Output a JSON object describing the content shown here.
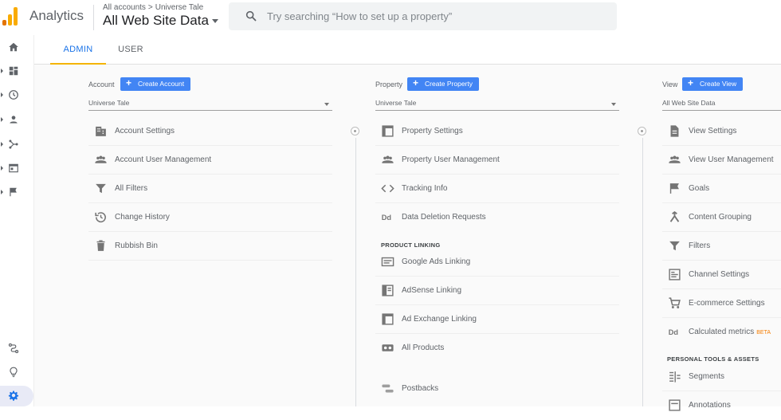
{
  "header": {
    "app_name": "Analytics",
    "breadcrumb": [
      "All accounts",
      "Universe Tale"
    ],
    "breadcrumb_sep": ">",
    "view_title": "All Web Site Data",
    "search_placeholder": "Try searching “How to set up a property”"
  },
  "colors": {
    "accent": "#1a73e8",
    "button": "#4285f4",
    "tab_underline": "#f4b400",
    "beta": "#f57c00"
  },
  "rail": {
    "items": [
      "home-icon",
      "dashboard-icon",
      "clock-icon",
      "person-icon",
      "acquisition-icon",
      "behavior-icon",
      "flag-icon"
    ],
    "bottom": [
      "attribution-icon",
      "lightbulb-icon",
      "gear-icon"
    ]
  },
  "tabs": [
    {
      "label": "ADMIN",
      "active": true
    },
    {
      "label": "USER",
      "active": false
    }
  ],
  "account": {
    "label": "Account",
    "create_label": "Create Account",
    "selected": "Universe Tale",
    "items": [
      {
        "label": "Account Settings",
        "icon": "building-icon"
      },
      {
        "label": "Account User Management",
        "icon": "people-icon"
      },
      {
        "label": "All Filters",
        "icon": "filter-icon"
      },
      {
        "label": "Change History",
        "icon": "history-icon"
      },
      {
        "label": "Rubbish Bin",
        "icon": "trash-icon"
      }
    ]
  },
  "property": {
    "label": "Property",
    "create_label": "Create Property",
    "selected": "Universe Tale",
    "items": [
      {
        "label": "Property Settings",
        "icon": "window-icon"
      },
      {
        "label": "Property User Management",
        "icon": "people-icon"
      },
      {
        "label": "Tracking Info",
        "icon": "code-icon"
      },
      {
        "label": "Data Deletion Requests",
        "icon": "dd-icon"
      }
    ],
    "linking_header": "PRODUCT LINKING",
    "linking_items": [
      {
        "label": "Google Ads Linking",
        "icon": "ads-icon"
      },
      {
        "label": "AdSense Linking",
        "icon": "adsense-icon"
      },
      {
        "label": "Ad Exchange Linking",
        "icon": "adexchange-icon"
      },
      {
        "label": "All Products",
        "icon": "link-icon"
      }
    ],
    "postbacks": {
      "label": "Postbacks",
      "icon": "postbacks-icon"
    }
  },
  "view": {
    "label": "View",
    "create_label": "Create View",
    "selected": "All Web Site Data",
    "items": [
      {
        "label": "View Settings",
        "icon": "document-icon"
      },
      {
        "label": "View User Management",
        "icon": "people-icon"
      },
      {
        "label": "Goals",
        "icon": "flag-icon"
      },
      {
        "label": "Content Grouping",
        "icon": "grouping-icon"
      },
      {
        "label": "Filters",
        "icon": "filter-icon"
      },
      {
        "label": "Channel Settings",
        "icon": "channel-icon"
      },
      {
        "label": "E-commerce Settings",
        "icon": "cart-icon"
      },
      {
        "label": "Calculated metrics",
        "icon": "dd-icon",
        "badge": "BETA"
      }
    ],
    "tools_header": "PERSONAL TOOLS & ASSETS",
    "tools_items": [
      {
        "label": "Segments",
        "icon": "segments-icon"
      },
      {
        "label": "Annotations",
        "icon": "annotations-icon"
      }
    ]
  }
}
